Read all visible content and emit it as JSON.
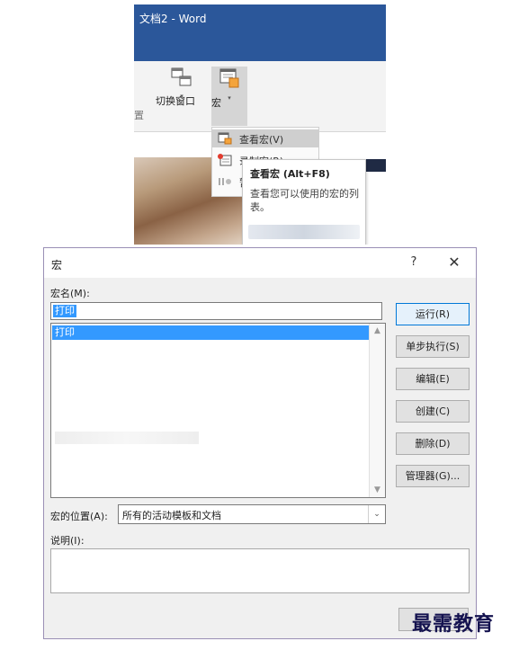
{
  "word": {
    "title": "文档2  -  Word",
    "ribbon_fragment": "置",
    "switch_window_label": "切换窗口",
    "macro_label": "宏",
    "dropdown_arrow": "▾",
    "menu": {
      "view_macros": "查看宏(V)",
      "record_macro": "录制宏(R)",
      "pause": "暂"
    },
    "tooltip": {
      "title": "查看宏 (Alt+F8)",
      "description": "查看您可以使用的宏的列表。"
    }
  },
  "dialog": {
    "title": "宏",
    "help_glyph": "?",
    "close_glyph": "✕",
    "macro_name_label": "宏名(M):",
    "macro_name_value": "打印",
    "macro_list": [
      "打印"
    ],
    "buttons": {
      "run": "运行(R)",
      "step_into": "单步执行(S)",
      "edit": "编辑(E)",
      "create": "创建(C)",
      "delete": "删除(D)",
      "organizer": "管理器(G)..."
    },
    "macros_in_label": "宏的位置(A):",
    "macros_in_value": "所有的活动模板和文档",
    "description_label": "说明(I):",
    "description_value": "",
    "scroll_up": "▲",
    "scroll_down": "▼",
    "select_arrow": "⌄"
  },
  "watermark": "最需教育",
  "colors": {
    "word_blue": "#2b579a",
    "selection_blue": "#3399ff",
    "dialog_border": "#9a8fb5",
    "watermark": "#14124f"
  }
}
